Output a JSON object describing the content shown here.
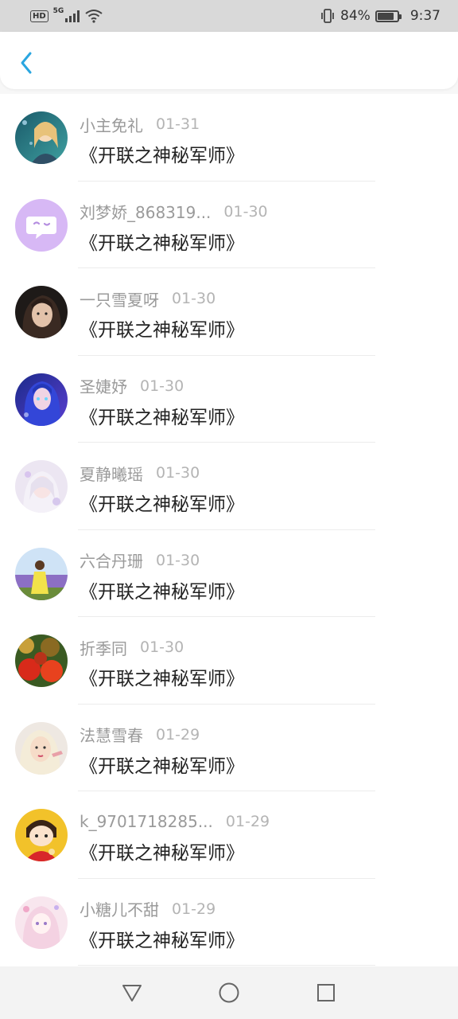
{
  "status_bar": {
    "hd_label": "HD",
    "network_label": "5G",
    "battery_percent": "84%",
    "battery_level": 0.84,
    "time": "9:37",
    "icons": [
      "signal-icon",
      "wifi-icon",
      "vibrate-icon",
      "battery-icon"
    ]
  },
  "header": {
    "back_icon": "chevron-left-icon",
    "accent_color": "#2aa6e0"
  },
  "messages": [
    {
      "name": "小主免礼",
      "date": "01-31",
      "content": "《开联之神秘军师》"
    },
    {
      "name": "刘梦娇_868319...",
      "date": "01-30",
      "content": "《开联之神秘军师》"
    },
    {
      "name": "一只雪夏呀",
      "date": "01-30",
      "content": "《开联之神秘军师》"
    },
    {
      "name": "圣婕妤",
      "date": "01-30",
      "content": "《开联之神秘军师》"
    },
    {
      "name": "夏静曦瑶",
      "date": "01-30",
      "content": "《开联之神秘军师》"
    },
    {
      "name": "六合丹珊",
      "date": "01-30",
      "content": "《开联之神秘军师》"
    },
    {
      "name": "折季同",
      "date": "01-30",
      "content": "《开联之神秘军师》"
    },
    {
      "name": "法慧雪春",
      "date": "01-29",
      "content": "《开联之神秘军师》"
    },
    {
      "name": "k_9701718285...",
      "date": "01-29",
      "content": "《开联之神秘军师》"
    },
    {
      "name": "小糖儿不甜",
      "date": "01-29",
      "content": "《开联之神秘军师》"
    }
  ],
  "nav_bar": {
    "icons": [
      "back-triangle-icon",
      "home-circle-icon",
      "recents-square-icon"
    ]
  }
}
